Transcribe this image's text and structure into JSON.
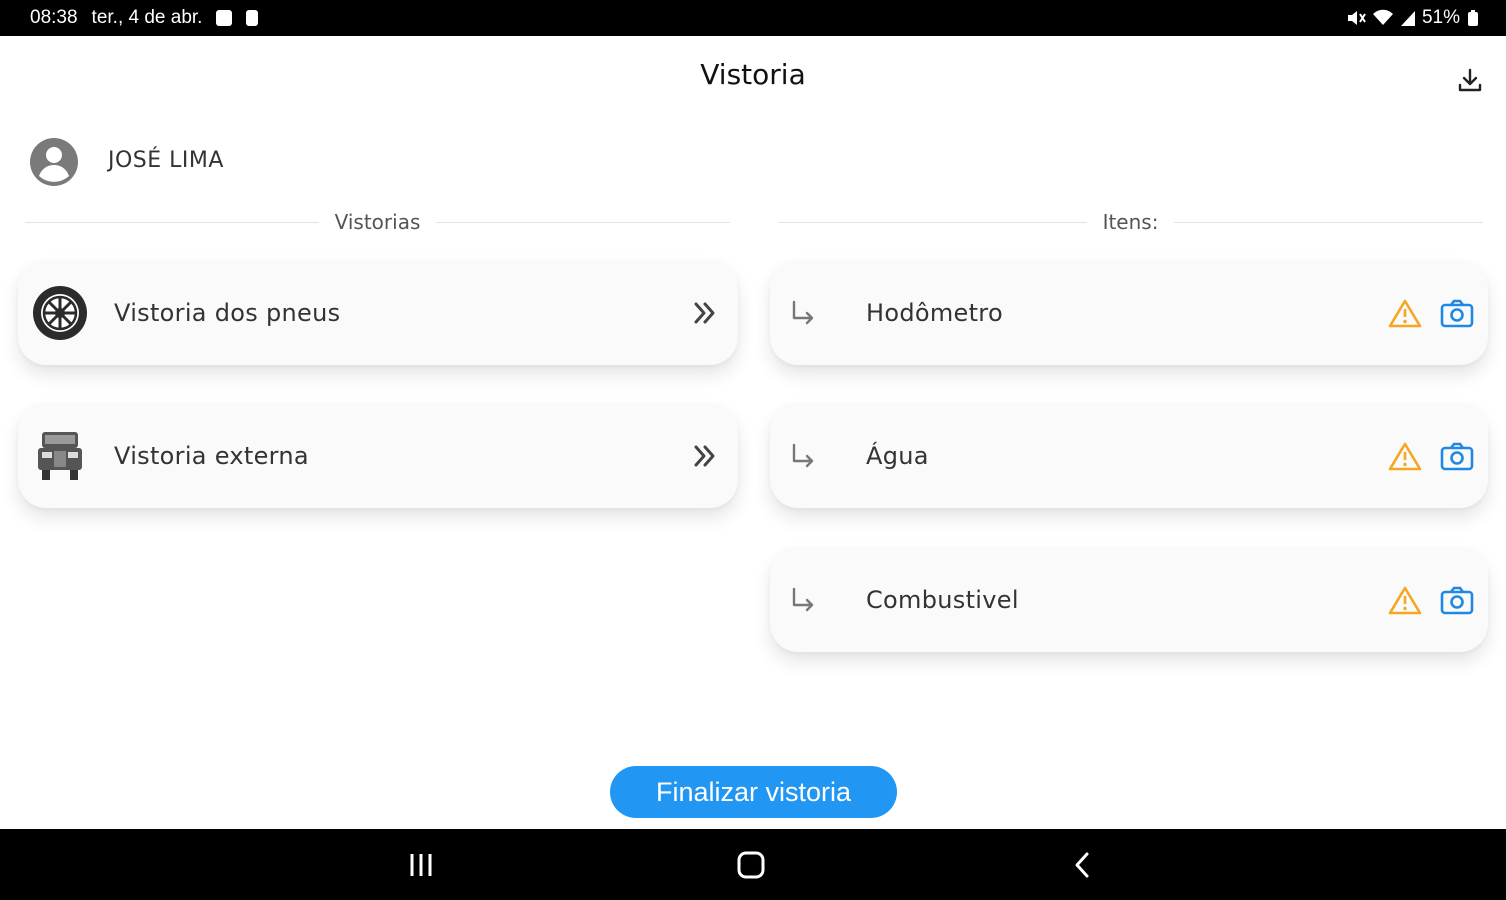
{
  "status_bar": {
    "time": "08:38",
    "date": "ter., 4 de abr.",
    "battery": "51%"
  },
  "header": {
    "title": "Vistoria",
    "download_icon": "download-icon"
  },
  "user": {
    "name": "JOSÉ LIMA",
    "avatar_icon": "account-circle-icon"
  },
  "vistorias": {
    "section_label": "Vistorias",
    "items": [
      {
        "label": "Vistoria dos pneus",
        "icon": "tire-icon"
      },
      {
        "label": "Vistoria externa",
        "icon": "truck-icon"
      }
    ]
  },
  "itens": {
    "section_label": "Itens:",
    "items": [
      {
        "label": "Hodômetro"
      },
      {
        "label": "Água"
      },
      {
        "label": "Combustivel"
      }
    ]
  },
  "footer": {
    "finalize_label": "Finalizar vistoria"
  },
  "colors": {
    "primary": "#2196f3",
    "warning": "#f5a623",
    "camera": "#1e88e5"
  }
}
